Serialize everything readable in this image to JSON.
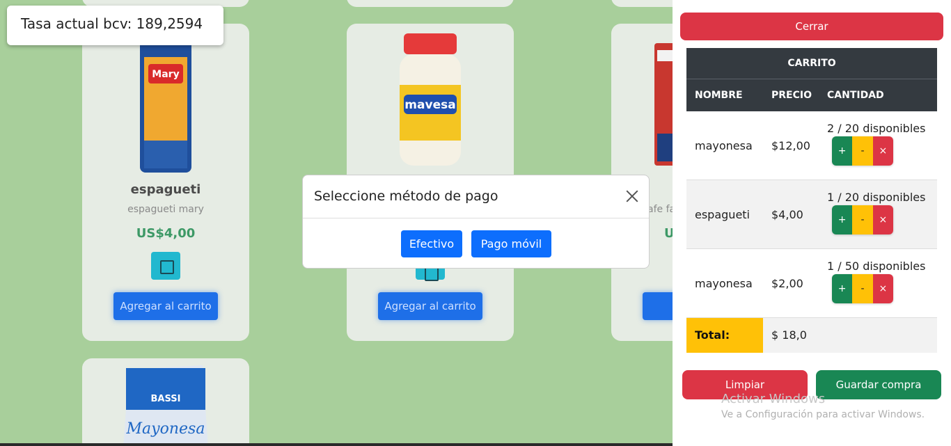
{
  "rate": {
    "label": "Tasa actual bcv: 189,2594"
  },
  "products": [
    {
      "title": "espagueti",
      "desc": "espagueti mary",
      "price": "US$4,00",
      "add_label": "Agregar al carrito"
    },
    {
      "title": "",
      "desc": "",
      "price": "",
      "add_label": "Agregar al carrito"
    },
    {
      "title": "",
      "desc": "afe fa",
      "price": "U",
      "add_label": "Agre"
    }
  ],
  "modal": {
    "title": "Seleccione método de pago",
    "cash_label": "Efectivo",
    "mobile_label": "Pago móvil"
  },
  "cart": {
    "close_label": "Cerrar",
    "header": "CARRITO",
    "columns": {
      "name": "NOMBRE",
      "price": "PRECIO",
      "qty": "CANTIDAD"
    },
    "rows": [
      {
        "name": "mayonesa",
        "price": "$12,00",
        "available": "2 / 20 disponibles",
        "plus": "+",
        "minus": "-",
        "del": "×"
      },
      {
        "name": "espagueti",
        "price": "$4,00",
        "available": "1 / 20 disponibles",
        "plus": "+",
        "minus": "-",
        "del": "×"
      },
      {
        "name": "mayonesa",
        "price": "$2,00",
        "available": "1 / 50 disponibles",
        "plus": "+",
        "minus": "-",
        "del": "×"
      }
    ],
    "total_label": "Total:",
    "total_value": "$ 18,0",
    "clear_label": "Limpiar",
    "save_label": "Guardar compra"
  },
  "watermark": {
    "line1": "Activar Windows",
    "line2": "Ve a Configuración para activar Windows."
  }
}
